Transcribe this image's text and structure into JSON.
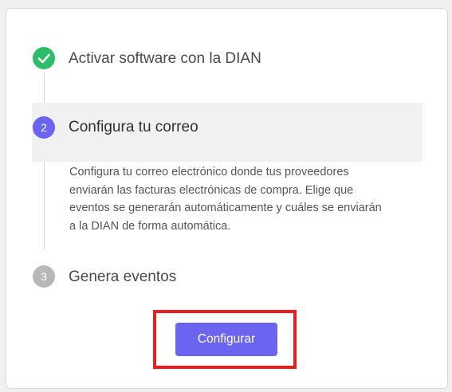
{
  "steps": [
    {
      "number": "1",
      "title": "Activar software con la DIAN",
      "status": "completed",
      "icon": "check-icon"
    },
    {
      "number": "2",
      "title": "Configura tu correo",
      "status": "active",
      "description": "Configura tu correo electrónico donde tus proveedores enviarán las facturas electrónicas de compra. Elige que eventos se generarán automáticamente y cuáles se enviarán a la DIAN de forma automática."
    },
    {
      "number": "3",
      "title": "Genera eventos",
      "status": "pending"
    }
  ],
  "action": {
    "label": "Configurar"
  },
  "colors": {
    "completed": "#2bbd68",
    "active": "#6a64f0",
    "pending": "#b8b8b8",
    "highlight": "#ee1c1c",
    "button": "#6a64f0"
  }
}
